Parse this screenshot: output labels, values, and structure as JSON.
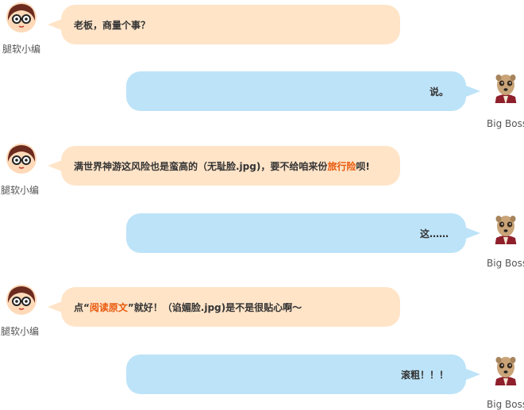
{
  "chat": {
    "editor_name": "腿软小编",
    "boss_name": "Big Boss",
    "messages": [
      {
        "sender": "editor",
        "text": "老板，商量个事？"
      },
      {
        "sender": "boss",
        "text": "说。"
      },
      {
        "sender": "editor",
        "text_before": "满世界神游这风险也是蛮高的（无耻脸.jpg)，要不给咱来份 ",
        "highlight": "旅行险",
        "text_after": " 呗!"
      },
      {
        "sender": "boss",
        "text": "这……"
      },
      {
        "sender": "editor",
        "text_before": "点“",
        "highlight": "阅读原文",
        "text_after": "”就好！（谄媚脸.jpg)是不是很贴心啊～"
      },
      {
        "sender": "boss",
        "text": "滚粗！！！"
      }
    ]
  },
  "colors": {
    "editor_bubble": "#ffe4c8",
    "boss_bubble": "#bde3f8",
    "highlight": "#e8590c",
    "text": "#333333"
  },
  "icons": {
    "editor_avatar": "girl-with-glasses-avatar",
    "boss_avatar": "meerkat-avatar"
  }
}
